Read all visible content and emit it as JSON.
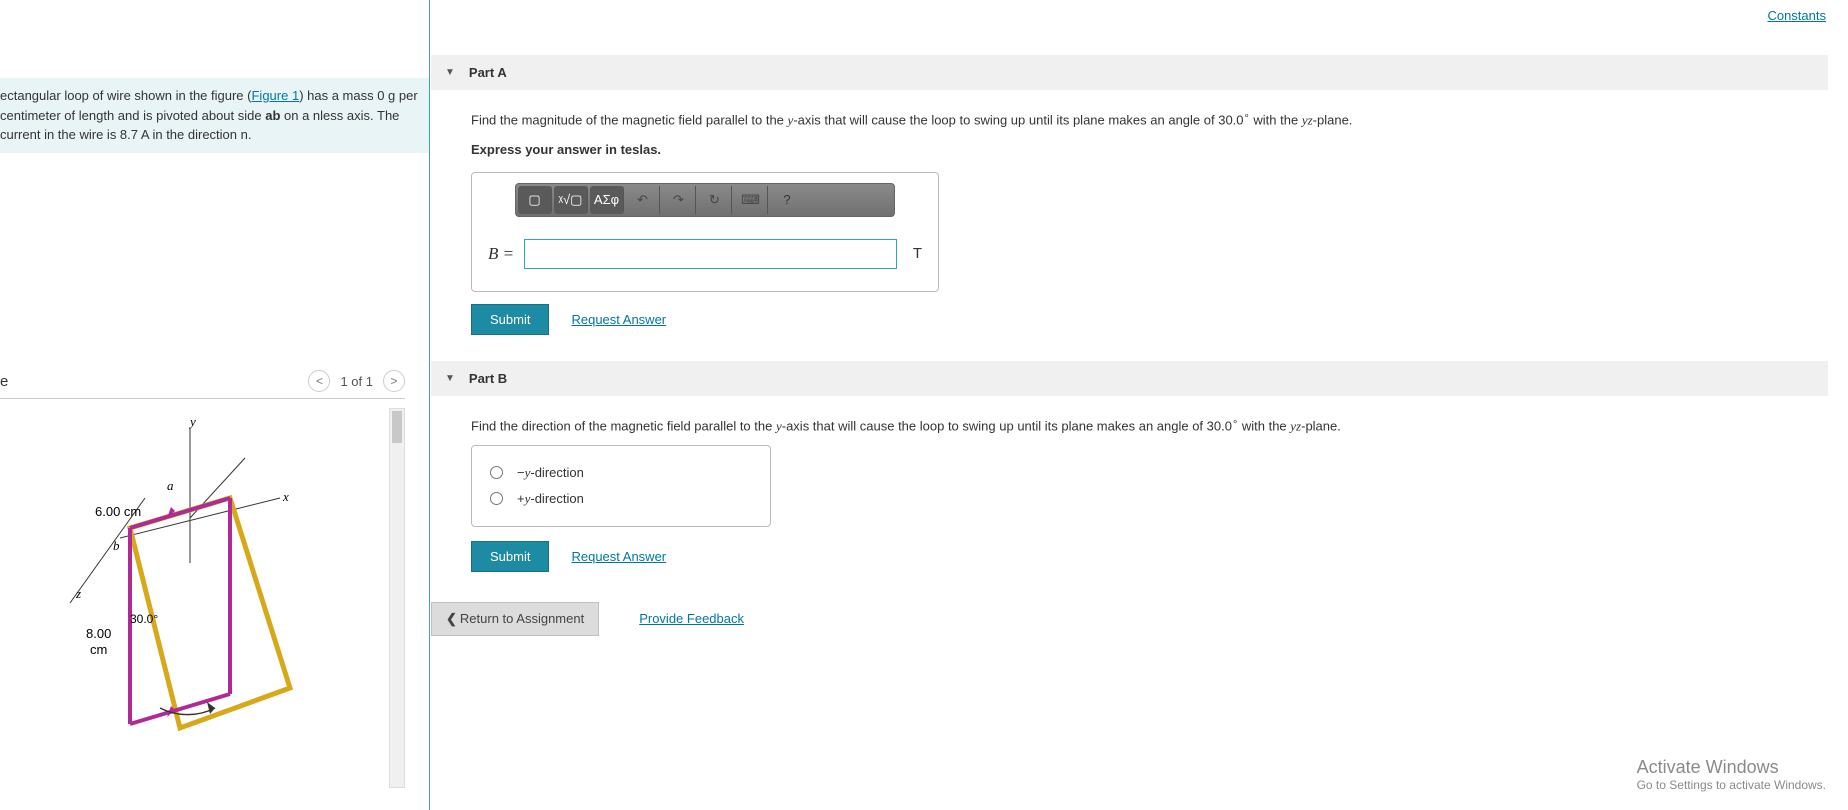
{
  "header": {
    "constants_link": "Constants"
  },
  "problem": {
    "text_before_link": "ectangular loop of wire shown in the figure (",
    "figure_link": "Figure 1",
    "text_after_link": ") has a mass 0 g per centimeter of length and is pivoted about side ",
    "bold_ab": "ab",
    "text_after_ab": " on a nless axis. The current in the wire is 8.7 A in the direction n."
  },
  "figure": {
    "title": "e",
    "pager": "1 of 1",
    "labels": {
      "y": "y",
      "x": "x",
      "z": "z",
      "a": "a",
      "b": "b",
      "dim1": "6.00 cm",
      "dim2": "8.00",
      "dim2u": "cm",
      "angle": "30.0°"
    }
  },
  "partA": {
    "header": "Part A",
    "question": "Find the magnitude of the magnetic field parallel to the y-axis that will cause the loop to swing up until its plane makes an angle of 30.0 ∘ with the yz-plane.",
    "express": "Express your answer in teslas.",
    "toolbar": {
      "tmpl": "▢",
      "sqrt": "ᵡ√▢",
      "greek": "ΑΣφ",
      "undo": "↶",
      "redo": "↷",
      "reset": "↻",
      "kbd": "⌨",
      "help": "?"
    },
    "lhs": "B =",
    "unit": "T",
    "submit": "Submit",
    "request": "Request Answer"
  },
  "partB": {
    "header": "Part B",
    "question": "Find the direction of the magnetic field parallel to the y-axis that will cause the loop to swing up until its plane makes an angle of 30.0 ∘ with the yz-plane.",
    "opt1": "−y-direction",
    "opt2": "+y-direction",
    "submit": "Submit",
    "request": "Request Answer"
  },
  "bottom": {
    "return": "Return to Assignment",
    "feedback": "Provide Feedback"
  },
  "watermark": {
    "line1": "Activate Windows",
    "line2": "Go to Settings to activate Windows."
  }
}
